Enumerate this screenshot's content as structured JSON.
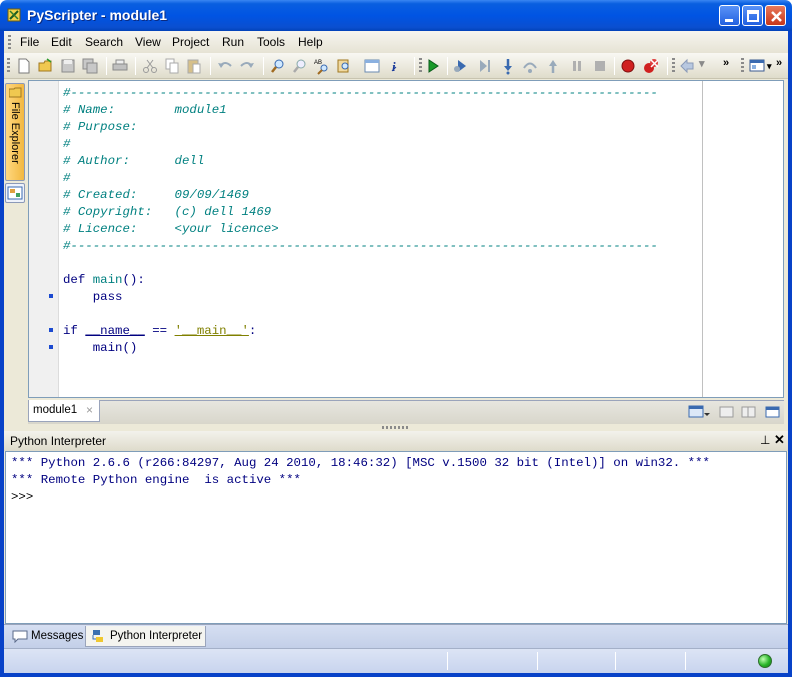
{
  "window": {
    "title": "PyScripter - module1"
  },
  "menu": {
    "items": [
      "File",
      "Edit",
      "Search",
      "View",
      "Project",
      "Run",
      "Tools",
      "Help"
    ]
  },
  "toolbar": {
    "icons": [
      "new-file-icon",
      "open-file-icon",
      "save-icon",
      "save-all-icon",
      "print-icon",
      "cut-icon",
      "copy-icon",
      "paste-icon",
      "undo-icon",
      "redo-icon",
      "find-icon",
      "find-next-icon",
      "replace-icon",
      "find-in-files-icon",
      "syntax-check-icon",
      "debug-info-icon",
      "run-icon",
      "debug-icon",
      "run-to-cursor-icon",
      "step-into-icon",
      "step-over-icon",
      "step-out-icon",
      "pause-icon",
      "abort-icon",
      "toggle-breakpoint-icon",
      "clear-breakpoints-icon",
      "back-icon",
      "layout-icon"
    ],
    "more_glyph": "»"
  },
  "left_dock": {
    "file_explorer_label": "File Explorer"
  },
  "editor": {
    "tab_label": "module1",
    "tab_close": "×",
    "lines": [
      "#-------------------------------------------------------------------------------",
      "# Name:        module1",
      "# Purpose:",
      "#",
      "# Author:      dell",
      "#",
      "# Created:     09/09/1469",
      "# Copyright:   (c) dell 1469",
      "# Licence:     <your licence>",
      "#-------------------------------------------------------------------------------",
      "",
      "def main():",
      "    pass",
      "",
      "if __name__ == '__main__':",
      "    main()"
    ],
    "code_tokens": {
      "def_kw": "def",
      "main_fn": "main",
      "def_rest": "():",
      "pass_kw": "    pass",
      "if_kw": "if ",
      "name_var": "__name__",
      "eq_op": " == ",
      "main_str": "'__main__'",
      "colon": ":",
      "call": "    main()"
    }
  },
  "interpreter": {
    "title": "Python Interpreter",
    "pin_glyph": "⊥",
    "close_glyph": "✕",
    "lines": [
      "*** Python 2.6.6 (r266:84297, Aug 24 2010, 18:46:32) [MSC v.1500 32 bit (Intel)] on win32. ***",
      "*** Remote Python engine  is active ***"
    ],
    "prompt": ">>>"
  },
  "bottom_tabs": {
    "messages": "Messages",
    "python_interpreter": "Python Interpreter"
  },
  "colors": {
    "title_blue": "#0054e3",
    "comment": "#008080",
    "string": "#808000",
    "keyword": "#000080",
    "status_led": "#29b52a"
  }
}
